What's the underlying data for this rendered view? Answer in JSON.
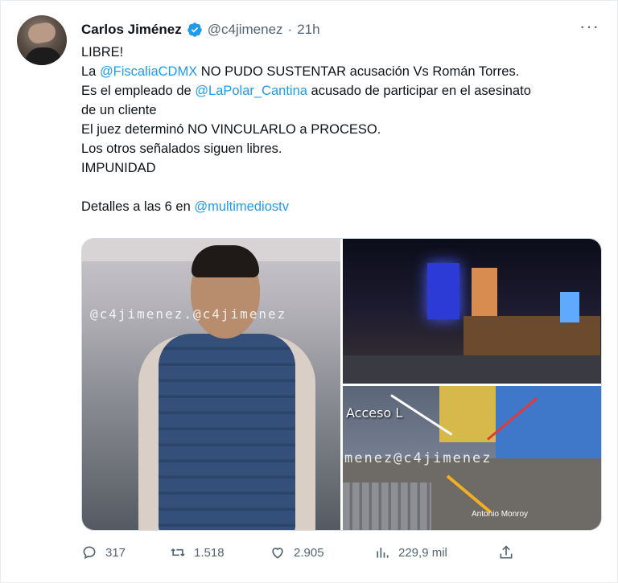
{
  "author": {
    "name": "Carlos Jiménez",
    "handle": "@c4jimenez",
    "separator": "·",
    "time": "21h"
  },
  "menu": {
    "more_label": "···"
  },
  "tweet": {
    "lines": [
      {
        "text": "LIBRE!"
      },
      {
        "pre": "La ",
        "mention": "@FiscaliaCDMX",
        "post": " NO PUDO SUSTENTAR acusación Vs Román Torres."
      },
      {
        "pre": "Es el empleado de ",
        "mention": "@LaPolar_Cantina",
        "post": " acusado de participar en el asesinato"
      },
      {
        "text": "de un cliente"
      },
      {
        "text": "El juez determinó NO VINCULARLO a PROCESO."
      },
      {
        "text": "Los otros señalados siguen libres."
      },
      {
        "text": "IMPUNIDAD"
      },
      {
        "pre": "Detalles a las 6 en ",
        "mention": "@multimediostv",
        "post": ""
      }
    ]
  },
  "media": {
    "watermark_left": "@c4jimenez.@c4jimenez",
    "watermark_right": "menez@c4jimenez",
    "label_acceso": "Acceso L",
    "label_victim": "Antonio Monroy"
  },
  "actions": {
    "replies": "317",
    "retweets": "1.518",
    "likes": "2.905",
    "views": "229,9 mil"
  },
  "colors": {
    "link": "#1d9bf0",
    "muted": "#536471",
    "verified": "#1d9bf0"
  },
  "icons": [
    "verified-badge-icon",
    "more-icon",
    "reply-icon",
    "retweet-icon",
    "like-icon",
    "analytics-icon",
    "share-icon"
  ]
}
